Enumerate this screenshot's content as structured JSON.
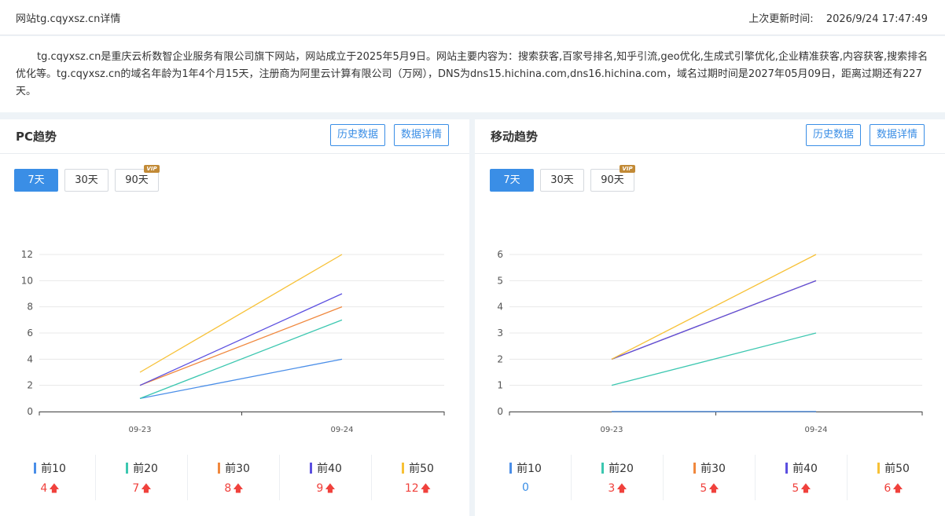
{
  "header": {
    "site_title": "网站tg.cqyxsz.cn详情",
    "updated_label": "上次更新时间:",
    "updated_value": "2026/9/24 17:47:49"
  },
  "description": "tg.cqyxsz.cn是重庆云析数智企业服务有限公司旗下网站，网站成立于2025年5月9日。网站主要内容为：搜索获客,百家号排名,知乎引流,geo优化,生成式引擎优化,企业精准获客,内容获客,搜索排名优化等。tg.cqyxsz.cn的域名年龄为1年4个月15天，注册商为阿里云计算有限公司（万网），DNS为dns15.hichina.com,dns16.hichina.com，域名过期时间是2027年05月09日，距离过期还有227天。",
  "panels": [
    {
      "title": "PC趋势",
      "history_label": "历史数据",
      "detail_label": "数据详情",
      "tabs": [
        {
          "label": "7天",
          "active": true,
          "vip": false
        },
        {
          "label": "30天",
          "active": false,
          "vip": false
        },
        {
          "label": "90天",
          "active": false,
          "vip": true
        }
      ],
      "vip_badge": "VIP",
      "legend": [
        {
          "name": "前10",
          "value": "4",
          "trend": "up",
          "color": "#4a8ee8"
        },
        {
          "name": "前20",
          "value": "7",
          "trend": "up",
          "color": "#3cc7b0"
        },
        {
          "name": "前30",
          "value": "8",
          "trend": "up",
          "color": "#f0883e"
        },
        {
          "name": "前40",
          "value": "9",
          "trend": "up",
          "color": "#5b4fe0"
        },
        {
          "name": "前50",
          "value": "12",
          "trend": "up",
          "color": "#f7c136"
        }
      ]
    },
    {
      "title": "移动趋势",
      "history_label": "历史数据",
      "detail_label": "数据详情",
      "tabs": [
        {
          "label": "7天",
          "active": true,
          "vip": false
        },
        {
          "label": "30天",
          "active": false,
          "vip": false
        },
        {
          "label": "90天",
          "active": false,
          "vip": true
        }
      ],
      "vip_badge": "VIP",
      "legend": [
        {
          "name": "前10",
          "value": "0",
          "trend": "flat",
          "color": "#4a8ee8"
        },
        {
          "name": "前20",
          "value": "3",
          "trend": "up",
          "color": "#3cc7b0"
        },
        {
          "name": "前30",
          "value": "5",
          "trend": "up",
          "color": "#f0883e"
        },
        {
          "name": "前40",
          "value": "5",
          "trend": "up",
          "color": "#5b4fe0"
        },
        {
          "name": "前50",
          "value": "6",
          "trend": "up",
          "color": "#f7c136"
        }
      ]
    }
  ],
  "chart_data": [
    {
      "type": "line",
      "x": [
        "09-23",
        "09-24"
      ],
      "ylim": [
        0,
        12
      ],
      "yticks": [
        0,
        2,
        4,
        6,
        8,
        10,
        12
      ],
      "grid": true,
      "series": [
        {
          "name": "前10",
          "color": "#4a8ee8",
          "values": [
            1,
            4
          ]
        },
        {
          "name": "前20",
          "color": "#3cc7b0",
          "values": [
            1,
            7
          ]
        },
        {
          "name": "前30",
          "color": "#f0883e",
          "values": [
            2,
            8
          ]
        },
        {
          "name": "前40",
          "color": "#5b4fe0",
          "values": [
            2,
            9
          ]
        },
        {
          "name": "前50",
          "color": "#f7c136",
          "values": [
            3,
            12
          ]
        }
      ]
    },
    {
      "type": "line",
      "x": [
        "09-23",
        "09-24"
      ],
      "ylim": [
        0,
        6
      ],
      "yticks": [
        0,
        1,
        2,
        3,
        4,
        5,
        6
      ],
      "grid": true,
      "series": [
        {
          "name": "前10",
          "color": "#4a8ee8",
          "values": [
            0,
            0
          ]
        },
        {
          "name": "前20",
          "color": "#3cc7b0",
          "values": [
            1,
            3
          ]
        },
        {
          "name": "前30",
          "color": "#f0883e",
          "values": [
            2,
            5
          ]
        },
        {
          "name": "前40",
          "color": "#5b4fe0",
          "values": [
            2,
            5
          ]
        },
        {
          "name": "前50",
          "color": "#f7c136",
          "values": [
            2,
            6
          ]
        }
      ]
    }
  ]
}
